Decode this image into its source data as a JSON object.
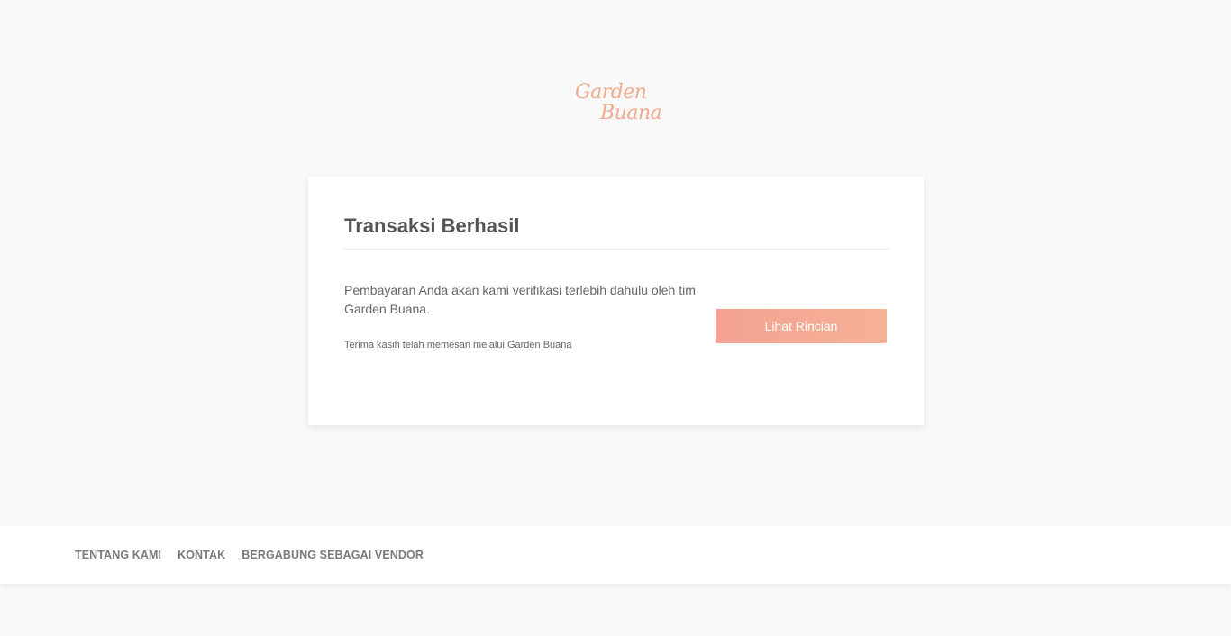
{
  "brand": {
    "logo_line1": "Garden",
    "logo_line2": "Buana",
    "logo_color": "#f2a98e"
  },
  "card": {
    "title": "Transaksi Berhasil",
    "message": "Pembayaran Anda akan kami verifikasi terlebih dahulu oleh tim Garden Buana.",
    "thanks": "Terima kasih telah memesan melalui Garden Buana",
    "button_label": "Lihat Rincian",
    "button_gradient": [
      "#f4a292",
      "#f6b196"
    ]
  },
  "footer": {
    "links": [
      {
        "label": "TENTANG KAMI"
      },
      {
        "label": "KONTAK"
      },
      {
        "label": "BERGABUNG SEBAGAI VENDOR"
      }
    ]
  }
}
